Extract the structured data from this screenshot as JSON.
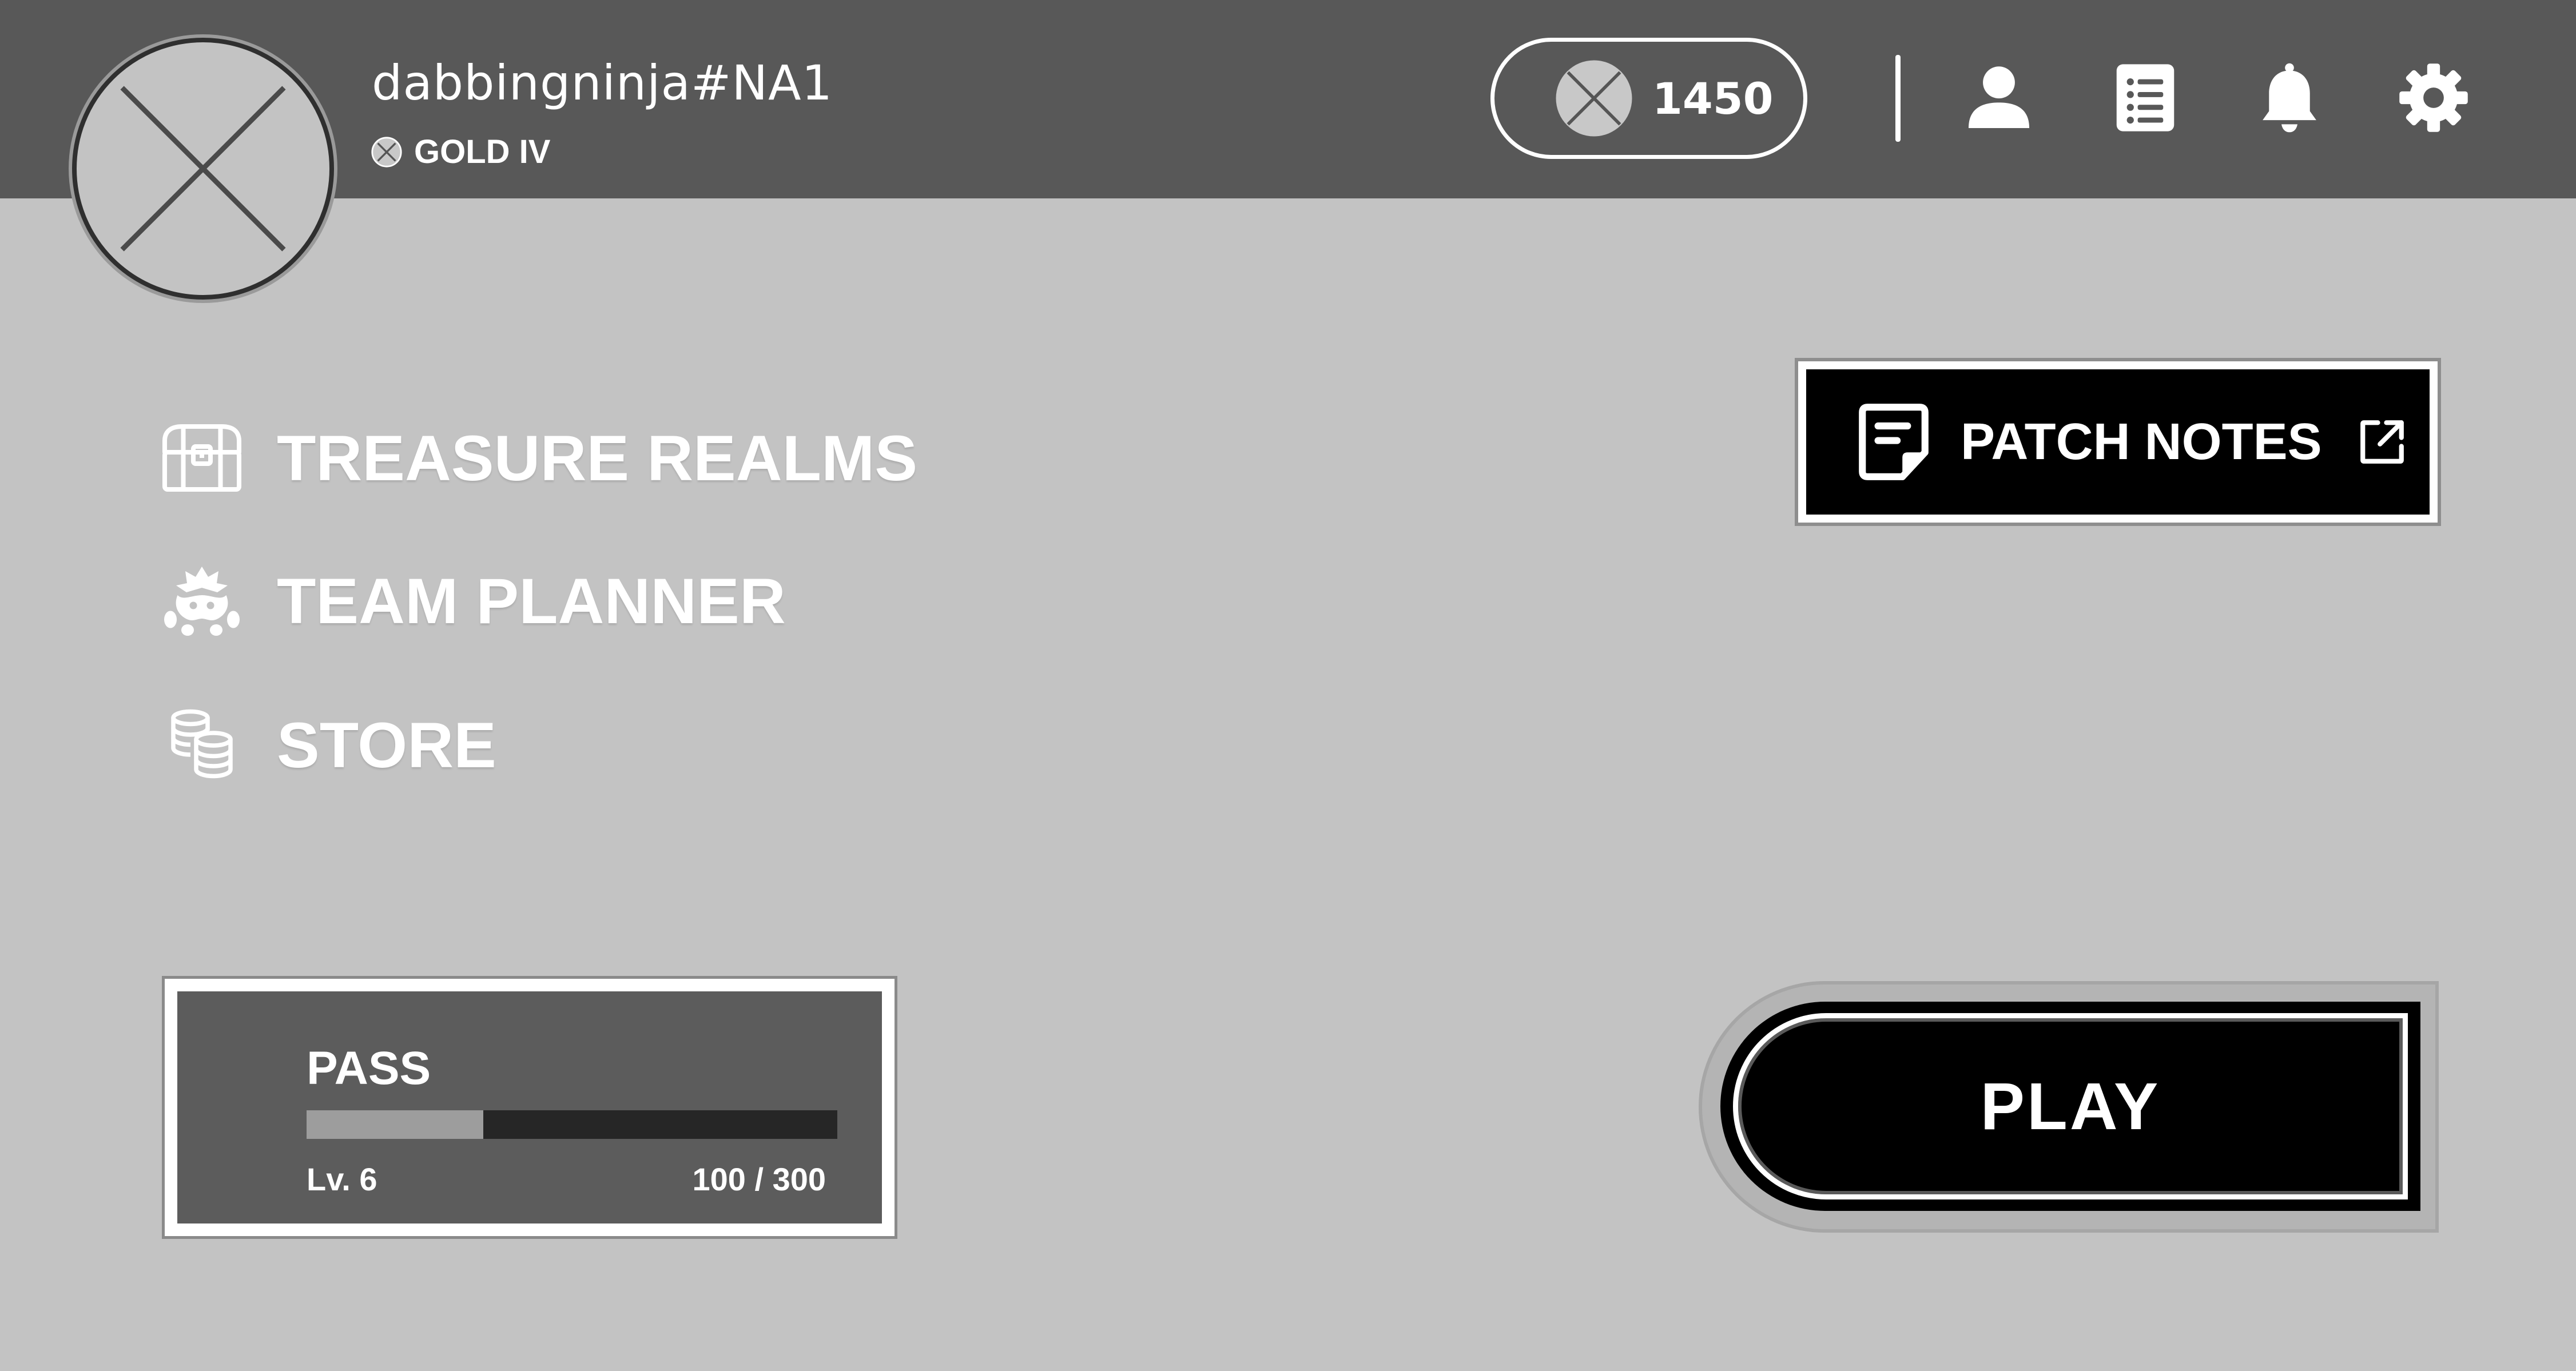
{
  "header": {
    "username": "dabbingninja#NA1",
    "rank": "GOLD IV",
    "currency_amount": "1450",
    "icons": {
      "avatar": "avatar-placeholder-icon",
      "rank": "rank-emblem-icon",
      "currency": "coin-icon",
      "profile": "profile-icon",
      "list": "list-icon",
      "notifications": "bell-icon",
      "settings": "gear-icon"
    }
  },
  "nav": {
    "items": [
      {
        "label": "TREASURE REALMS",
        "icon": "treasure-chest-icon"
      },
      {
        "label": "TEAM PLANNER",
        "icon": "team-planner-icon"
      },
      {
        "label": "STORE",
        "icon": "coin-stack-icon"
      }
    ]
  },
  "patch_notes": {
    "label": "PATCH NOTES",
    "icon": "document-icon",
    "external_icon": "external-link-icon"
  },
  "pass": {
    "title": "PASS",
    "level_label": "Lv. 6",
    "progress_label": "100 / 300",
    "progress_current": 100,
    "progress_max": 300
  },
  "play": {
    "label": "PLAY"
  },
  "colors": {
    "background": "#c3c3c3",
    "topbar": "#585858",
    "pass_card": "#5c5c5c",
    "pass_fill": "#9d9d9d",
    "pass_track": "#262626",
    "button_dark": "#000000",
    "text_light": "#ffffff"
  }
}
